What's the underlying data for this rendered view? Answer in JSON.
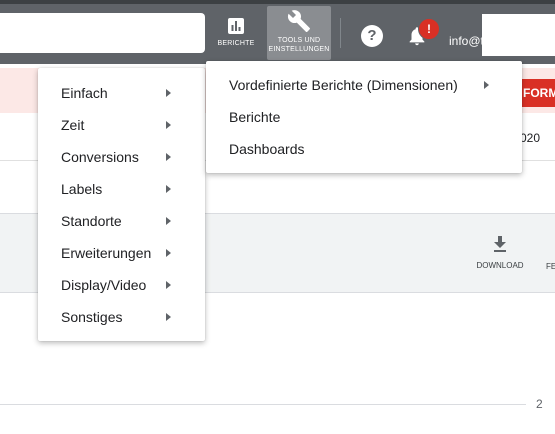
{
  "topbar": {
    "reports_label": "BERICHTE",
    "tools_label_1": "TOOLS UND",
    "tools_label_2": "EINSTELLUNGEN",
    "help_glyph": "?",
    "notification_badge": "!",
    "account_text": "info@t"
  },
  "page": {
    "alert_button_label": "FORM",
    "date_fragment": "020",
    "download_label": "DOWNLOAD",
    "cut_toolbar_label": "FE",
    "pagination_value": "2"
  },
  "menus": {
    "categories": [
      {
        "label": "Einfach"
      },
      {
        "label": "Zeit"
      },
      {
        "label": "Conversions"
      },
      {
        "label": "Labels"
      },
      {
        "label": "Standorte"
      },
      {
        "label": "Erweiterungen"
      },
      {
        "label": "Display/Video"
      },
      {
        "label": "Sonstiges"
      }
    ],
    "reports": [
      {
        "label": "Vordefinierte Berichte (Dimensionen)"
      },
      {
        "label": "Berichte"
      },
      {
        "label": "Dashboards"
      }
    ]
  },
  "colors": {
    "topbar": "#5f6368",
    "active_tool": "#8a8d91",
    "alert_red": "#d93025",
    "alert_band": "#fce8e6",
    "toolbar_band": "#f1f3f4"
  },
  "icons": [
    "bar-chart-icon",
    "wrench-icon",
    "help-icon",
    "bell-icon",
    "download-icon",
    "submenu-arrow-icon"
  ]
}
